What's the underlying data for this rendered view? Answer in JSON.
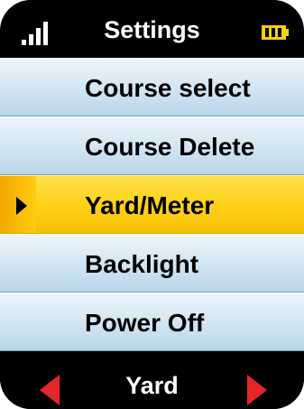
{
  "header": {
    "title": "Settings",
    "signal_icon": "signal-bars-icon",
    "battery_icon": "battery-icon",
    "battery_color": "#f2d200"
  },
  "menu": {
    "items": [
      {
        "label": "Course select",
        "selected": false
      },
      {
        "label": "Course Delete",
        "selected": false
      },
      {
        "label": "Yard/Meter",
        "selected": true
      },
      {
        "label": "Backlight",
        "selected": false
      },
      {
        "label": "Power Off",
        "selected": false
      }
    ],
    "selection_color": "#ffd21a",
    "item_color": "#d6e8f4"
  },
  "footer": {
    "value": "Yard",
    "left_icon": "arrow-left-icon",
    "right_icon": "arrow-right-icon",
    "arrow_color": "#e3262a"
  }
}
